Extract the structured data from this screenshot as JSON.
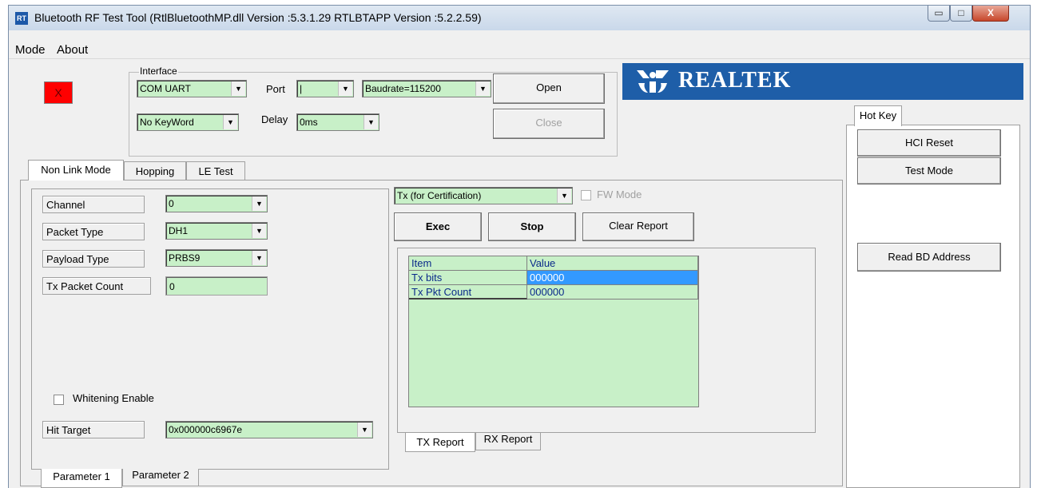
{
  "window": {
    "title": "Bluetooth RF Test Tool (RtlBluetoothMP.dll Version :5.3.1.29   RTLBTAPP Version :5.2.2.59)",
    "minimize": "▭",
    "maximize": "□",
    "close": "X",
    "icon_text": "RT"
  },
  "menu": {
    "mode": "Mode",
    "about": "About"
  },
  "status_indicator": {
    "text": "X",
    "color": "#ff0000"
  },
  "interface": {
    "legend": "Interface",
    "connection": "COM UART",
    "port_label": "Port",
    "port_value": "|",
    "baudrate": "Baudrate=115200",
    "keyword": "No KeyWord",
    "delay_label": "Delay",
    "delay_value": "0ms",
    "open_button": "Open",
    "close_button": "Close"
  },
  "brand": {
    "text": "REALTEK",
    "color": "#1e5ea8"
  },
  "tabs": [
    "Non Link Mode",
    "Hopping",
    "LE Test"
  ],
  "parameters": {
    "channel_label": "Channel",
    "channel_value": "0",
    "packet_type_label": "Packet Type",
    "packet_type_value": "DH1",
    "payload_type_label": "Payload Type",
    "payload_type_value": "PRBS9",
    "tx_packet_count_label": "Tx Packet Count",
    "tx_packet_count_value": "0",
    "whitening_label": "Whitening Enable",
    "hit_target_label": "Hit Target",
    "hit_target_value": "0x000000c6967e",
    "subtabs": [
      "Parameter 1",
      "Parameter 2"
    ]
  },
  "test": {
    "mode_value": "Tx (for Certification)",
    "fw_mode_label": "FW Mode",
    "exec_button": "Exec",
    "stop_button": "Stop",
    "clear_button": "Clear Report",
    "report_headers": [
      "Item",
      "Value"
    ],
    "report_rows": [
      {
        "item": "Tx bits",
        "value": "000000"
      },
      {
        "item": "Tx Pkt Count",
        "value": "000000"
      }
    ],
    "report_tabs": [
      "TX Report",
      "RX Report"
    ]
  },
  "hotkey": {
    "tab": "Hot Key",
    "hci_reset": "HCI Reset",
    "test_mode": "Test Mode",
    "read_bd_address": "Read BD Address"
  }
}
